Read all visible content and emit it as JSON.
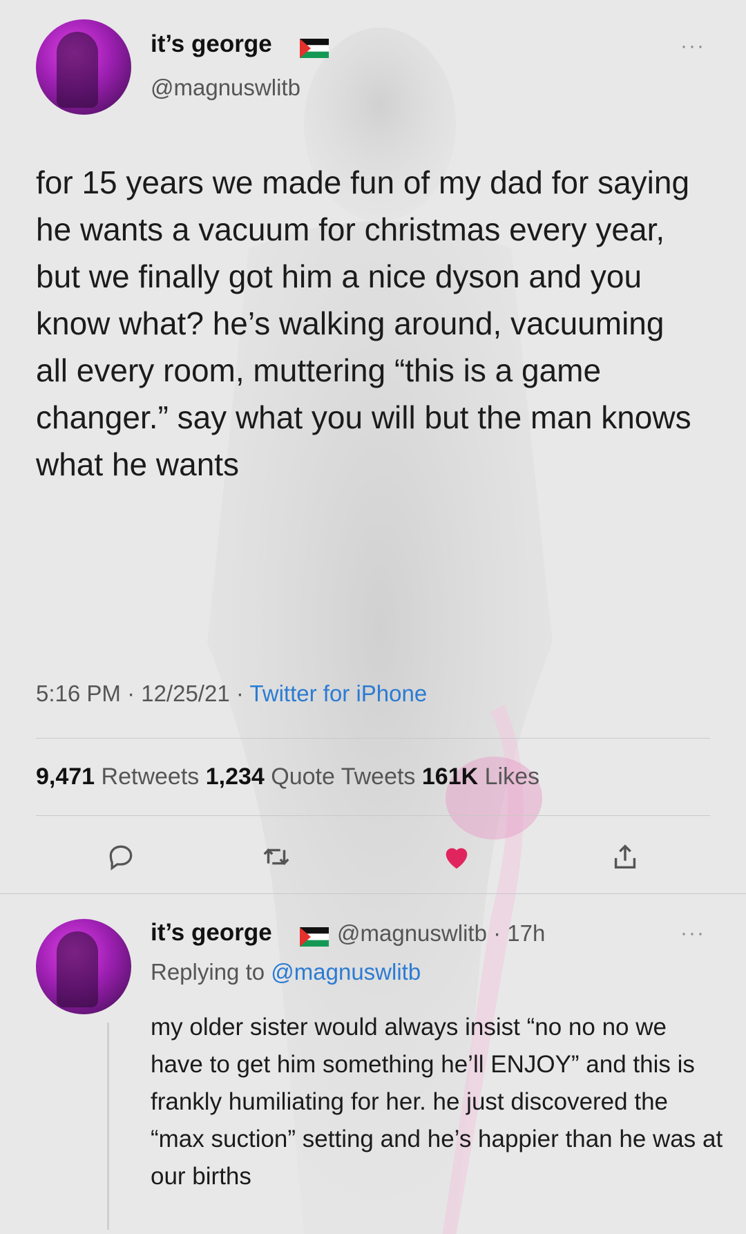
{
  "main_tweet": {
    "display_name": "it’s george",
    "handle": "@magnuswlitb",
    "more_label": "···",
    "text": "for 15 years we made fun of my dad for saying he wants a vacuum for christmas every year, but we finally got him a nice dyson and you know what? he’s walking around, vacuuming all every room, muttering “this is a game changer.” say what you will but the man knows what he wants",
    "time": "5:16 PM · 12/25/21 · ",
    "source": "Twitter for iPhone",
    "stats": {
      "retweets_count": "9,471",
      "retweets_label": " Retweets ",
      "quotes_count": "1,234",
      "quotes_label": " Quote Tweets ",
      "likes_count": "161K",
      "likes_label": " Likes"
    }
  },
  "reply_tweet": {
    "display_name": "it’s george",
    "handle_time": "@magnuswlitb · 17h",
    "more_label": "···",
    "replying_prefix": "Replying to ",
    "replying_to": "@magnuswlitb",
    "text": "my older sister would always insist “no no no we have to get him something he’ll ENJOY” and this is frankly humiliating for her. he just discovered the “max suction” setting and he’s happier than he was at our births"
  },
  "icons": {
    "reply": "reply-icon",
    "retweet": "retweet-icon",
    "like": "heart-icon",
    "share": "share-icon",
    "flag": "palestine-flag-icon"
  },
  "colors": {
    "link": "#2b7bd3",
    "like": "#e0245e",
    "background": "#e8e8e8"
  }
}
